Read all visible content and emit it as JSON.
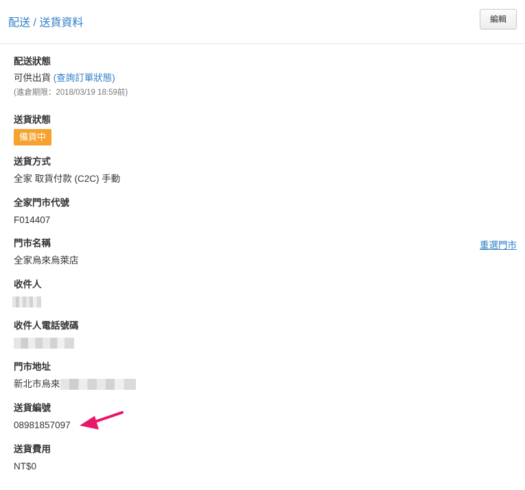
{
  "header": {
    "title": "配送 / 送貨資料",
    "edit_label": "編輯"
  },
  "fields": {
    "delivery_status": {
      "label": "配送狀態",
      "value": "可供出貨",
      "link": "(查詢訂單狀態)",
      "note": "(進倉期限：2018/03/19 18:59前)"
    },
    "shipping_status": {
      "label": "送貨狀態",
      "badge": "備貨中",
      "badge_color": "#f5a22f"
    },
    "shipping_method": {
      "label": "送貨方式",
      "value": "全家 取貨付款 (C2C) 手動"
    },
    "store_code": {
      "label": "全家門市代號",
      "value": "F014407"
    },
    "store_name": {
      "label": "門市名稱",
      "value": "全家烏來烏萊店",
      "reselect": "重選門市"
    },
    "recipient": {
      "label": "收件人"
    },
    "recipient_phone": {
      "label": "收件人電話號碼"
    },
    "store_address": {
      "label": "門市地址",
      "value": "新北市烏來"
    },
    "tracking_number": {
      "label": "送貨編號",
      "value": "08981857097"
    },
    "shipping_fee": {
      "label": "送貨費用",
      "value": "NT$0"
    }
  },
  "colors": {
    "accent": "#2f7fc8",
    "annotation_arrow": "#e8176b"
  }
}
